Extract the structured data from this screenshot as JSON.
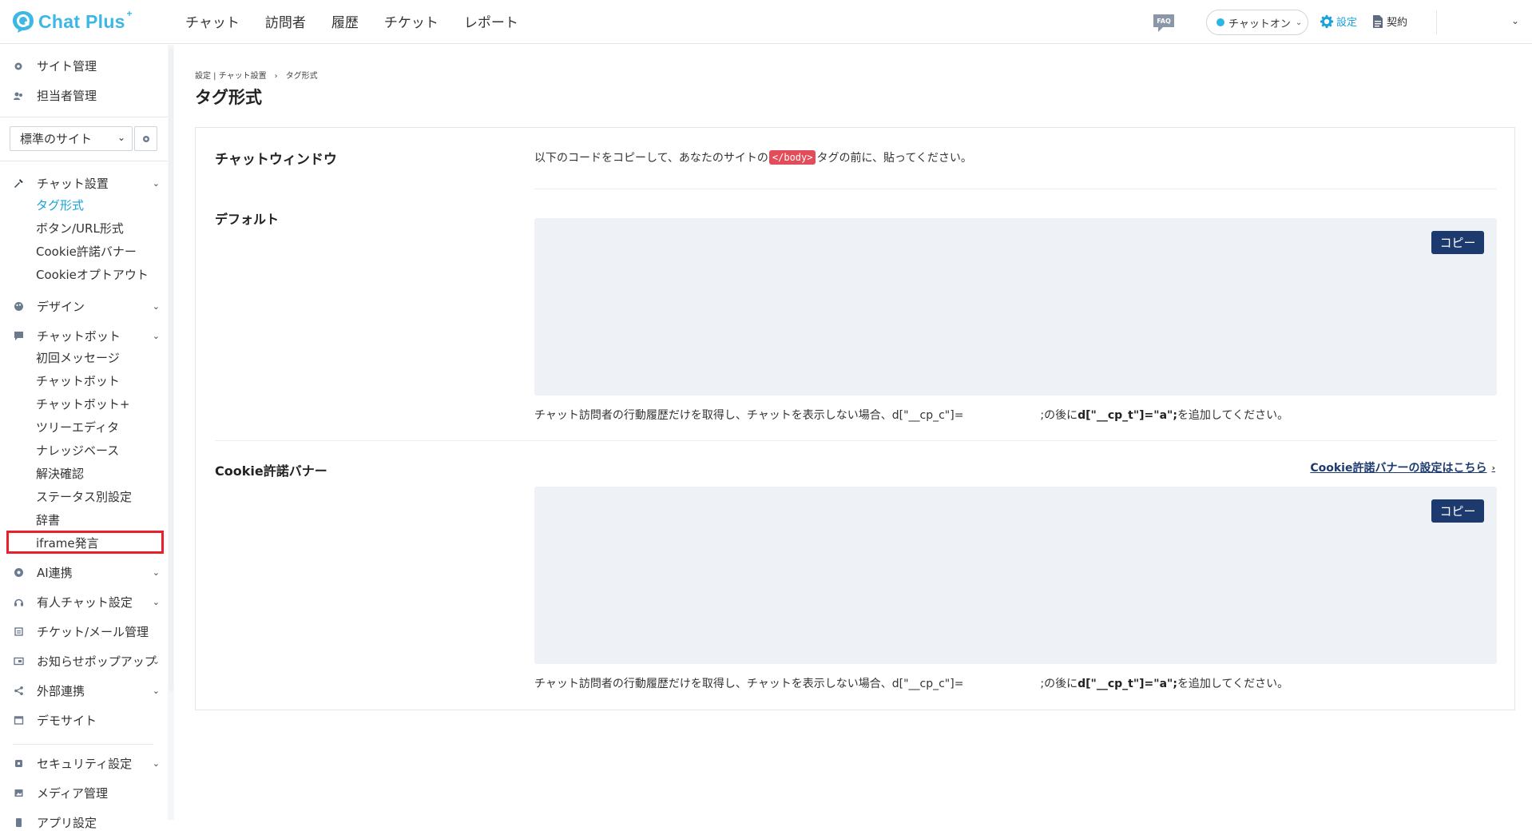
{
  "header": {
    "logo_text": "Chat Plus",
    "logo_sup": "+",
    "nav": [
      "チャット",
      "訪問者",
      "履歴",
      "チケット",
      "レポート"
    ],
    "faq_label": "FAQ",
    "status_label": "チャットオン",
    "settings_label": "設定",
    "contract_label": "契約",
    "accent_color": "#1aa3d8"
  },
  "sidebar": {
    "site_manage": "サイト管理",
    "staff_manage": "担当者管理",
    "site_select_value": "標準のサイト",
    "sections": {
      "chat_settings": "チャット設置",
      "design": "デザイン",
      "chatbot": "チャットボット",
      "ai": "AI連携",
      "human_chat": "有人チャット設定",
      "ticket": "チケット/メール管理",
      "popup": "お知らせポップアップ",
      "external": "外部連携",
      "demo": "デモサイト",
      "security": "セキュリティ設定",
      "media": "メディア管理",
      "app": "アプリ設定"
    },
    "chat_settings_items": [
      "タグ形式",
      "ボタン/URL形式",
      "Cookie許諾バナー",
      "Cookieオプトアウト"
    ],
    "chatbot_items": [
      "初回メッセージ",
      "チャットボット",
      "チャットボット+",
      "ツリーエディタ",
      "ナレッジベース",
      "解決確認",
      "ステータス別設定",
      "辞書",
      "iframe発言"
    ]
  },
  "main": {
    "breadcrumb": "設定 | チャット設置　›　タグ形式",
    "title": "タグ形式",
    "section1_label": "チャットウィンドウ",
    "instruction_pre": "以下のコードをコピーして、あなたのサイトの",
    "instruction_tag": "</body>",
    "instruction_post": "タグの前に、貼ってください。",
    "default_label": "デフォルト",
    "copy_label": "コピー",
    "note_pre": "チャット訪問者の行動履歴だけを取得し、チャットを表示しない場合、d[\"__cp_c\"]=",
    "note_mid": ";の後に",
    "note_code": "d[\"__cp_t\"]=\"a\";",
    "note_post": "を追加してください。",
    "cookie_label": "Cookie許諾バナー",
    "cookie_link": "Cookie許諾バナーの設定はこちら"
  }
}
